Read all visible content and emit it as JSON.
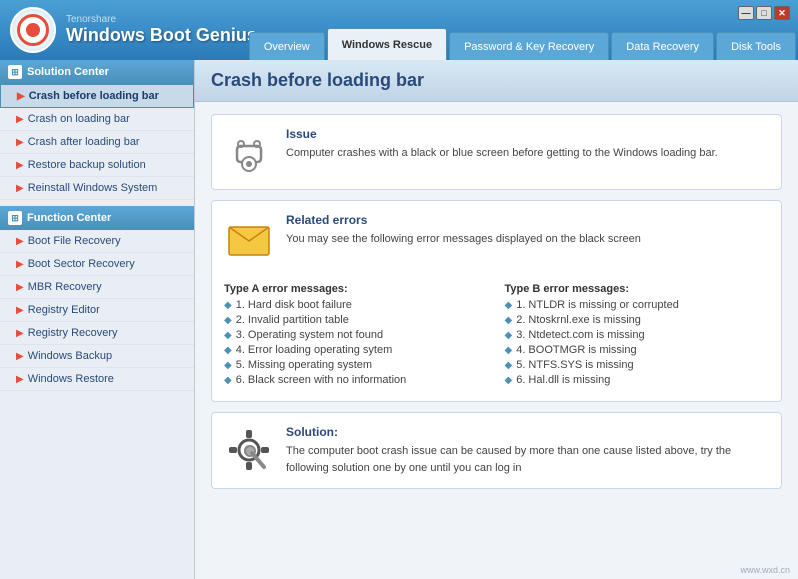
{
  "app": {
    "company": "Tenorshare",
    "name": "Windows Boot Genius",
    "window_controls": {
      "minimize": "—",
      "maximize": "□",
      "close": "✕"
    }
  },
  "nav": {
    "tabs": [
      {
        "id": "overview",
        "label": "Overview",
        "active": false
      },
      {
        "id": "windows-rescue",
        "label": "Windows Rescue",
        "active": true
      },
      {
        "id": "password-recovery",
        "label": "Password & Key Recovery",
        "active": false
      },
      {
        "id": "data-recovery",
        "label": "Data Recovery",
        "active": false
      },
      {
        "id": "disk-tools",
        "label": "Disk Tools",
        "active": false
      }
    ]
  },
  "sidebar": {
    "solution_center": {
      "header": "Solution Center",
      "items": [
        {
          "id": "crash-before",
          "label": "Crash before loading bar",
          "active": true
        },
        {
          "id": "crash-on",
          "label": "Crash on loading bar",
          "active": false
        },
        {
          "id": "crash-after",
          "label": "Crash after loading bar",
          "active": false
        },
        {
          "id": "restore-backup",
          "label": "Restore backup solution",
          "active": false
        },
        {
          "id": "reinstall-windows",
          "label": "Reinstall Windows System",
          "active": false
        }
      ]
    },
    "function_center": {
      "header": "Function Center",
      "items": [
        {
          "id": "boot-file",
          "label": "Boot File Recovery",
          "active": false
        },
        {
          "id": "boot-sector",
          "label": "Boot Sector Recovery",
          "active": false
        },
        {
          "id": "mbr-recovery",
          "label": "MBR Recovery",
          "active": false
        },
        {
          "id": "registry-editor",
          "label": "Registry Editor",
          "active": false
        },
        {
          "id": "registry-recovery",
          "label": "Registry Recovery",
          "active": false
        },
        {
          "id": "windows-backup",
          "label": "Windows Backup",
          "active": false
        },
        {
          "id": "windows-restore",
          "label": "Windows Restore",
          "active": false
        }
      ]
    }
  },
  "content": {
    "title": "Crash before loading bar",
    "issue_card": {
      "title": "Issue",
      "text": "Computer crashes with a black or blue screen before getting to the Windows loading bar."
    },
    "related_errors_card": {
      "title": "Related errors",
      "text": "You may see the following error messages displayed on the black screen",
      "type_a": {
        "heading": "Type A error messages:",
        "items": [
          "1. Hard disk boot failure",
          "2. Invalid partition table",
          "3. Operating system not found",
          "4. Error loading operating sytem",
          "5. Missing operating system",
          "6. Black screen with no information"
        ]
      },
      "type_b": {
        "heading": "Type B error messages:",
        "items": [
          "1. NTLDR is missing or corrupted",
          "2. Ntoskrnl.exe is missing",
          "3. Ntdetect.com is missing",
          "4. BOOTMGR is missing",
          "5. NTFS.SYS is missing",
          "6. Hal.dll is missing"
        ]
      }
    },
    "solution_card": {
      "title": "Solution:",
      "text": "The computer boot crash issue can be caused by more than one cause listed above, try the following solution one by one until you can log in"
    }
  },
  "watermark": "www.wxd.cn"
}
